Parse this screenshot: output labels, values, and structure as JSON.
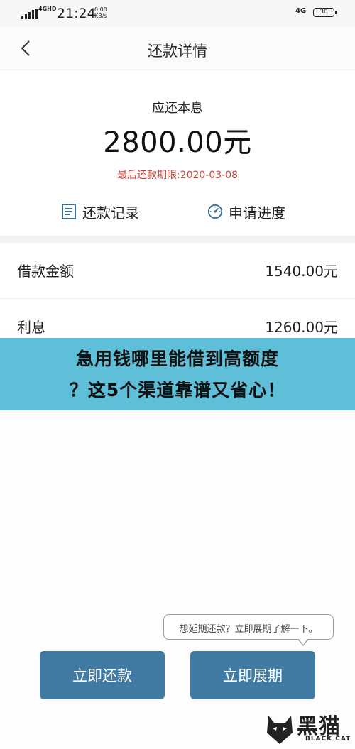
{
  "status_bar": {
    "network": "4GHD",
    "time": "21:24",
    "speed_value": "0.00",
    "speed_unit": "KB/s",
    "network_right": "4G",
    "battery": "30"
  },
  "nav": {
    "title": "还款详情"
  },
  "summary": {
    "label": "应还本息",
    "amount": "2800.00元",
    "deadline": "最后还款期限:2020-03-08"
  },
  "actions": {
    "record": "还款记录",
    "progress": "申请进度"
  },
  "details": [
    {
      "label": "借款金额",
      "value": "1540.00元"
    },
    {
      "label": "利息",
      "value": "1260.00元"
    }
  ],
  "banner": {
    "line1": "急用钱哪里能借到高额度",
    "line2": "？这5个渠道靠谱又省心！"
  },
  "tooltip": {
    "text": "想延期还款？立即展期了解一下。"
  },
  "buttons": {
    "pay": "立即还款",
    "extend": "立即展期"
  },
  "watermark": {
    "cn": "黑猫",
    "en": "BLACK CAT"
  },
  "colors": {
    "accent_button": "#417ba3",
    "deadline_red": "#c3443a",
    "banner_blue": "#5fbfd9",
    "icon_blue": "#3a6f96"
  }
}
